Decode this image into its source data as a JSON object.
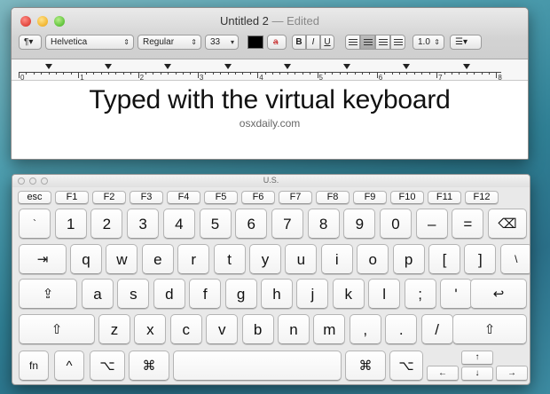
{
  "textedit": {
    "title": "Untitled 2",
    "title_sep": " — ",
    "status": "Edited",
    "toolbar": {
      "styles_label": "¶▾",
      "font_family": "Helvetica",
      "font_style": "Regular",
      "font_size": "33",
      "text_color": "#000000",
      "highlight_label": "a",
      "bold_label": "B",
      "italic_label": "I",
      "underline_label": "U",
      "line_spacing": "1.0",
      "list_label": "☰▾"
    },
    "ruler_numbers": [
      "0",
      "1",
      "2",
      "3",
      "4",
      "5",
      "6",
      "7",
      "8"
    ],
    "document": {
      "heading": "Typed with the virtual keyboard",
      "subheading": "osxdaily.com"
    }
  },
  "keyboard": {
    "title": "U.S.",
    "rows": {
      "function": [
        "esc",
        "F1",
        "F2",
        "F3",
        "F4",
        "F5",
        "F6",
        "F7",
        "F8",
        "F9",
        "F10",
        "F11",
        "F12"
      ],
      "number": [
        "`",
        "1",
        "2",
        "3",
        "4",
        "5",
        "6",
        "7",
        "8",
        "9",
        "0",
        "–",
        "=",
        "⌫"
      ],
      "qwerty": [
        "⇥",
        "q",
        "w",
        "e",
        "r",
        "t",
        "y",
        "u",
        "i",
        "o",
        "p",
        "[",
        "]",
        "\\"
      ],
      "home": [
        "⇪",
        "a",
        "s",
        "d",
        "f",
        "g",
        "h",
        "j",
        "k",
        "l",
        ";",
        "'",
        "↩"
      ],
      "shift": [
        "⇧",
        "z",
        "x",
        "c",
        "v",
        "b",
        "n",
        "m",
        ",",
        ".",
        "/",
        "⇧"
      ],
      "bottom": [
        "fn",
        "^",
        "⌥",
        "⌘",
        "",
        "⌘",
        "⌥"
      ],
      "arrows": {
        "left": "←",
        "up": "↑",
        "down": "↓",
        "right": "→"
      }
    }
  }
}
